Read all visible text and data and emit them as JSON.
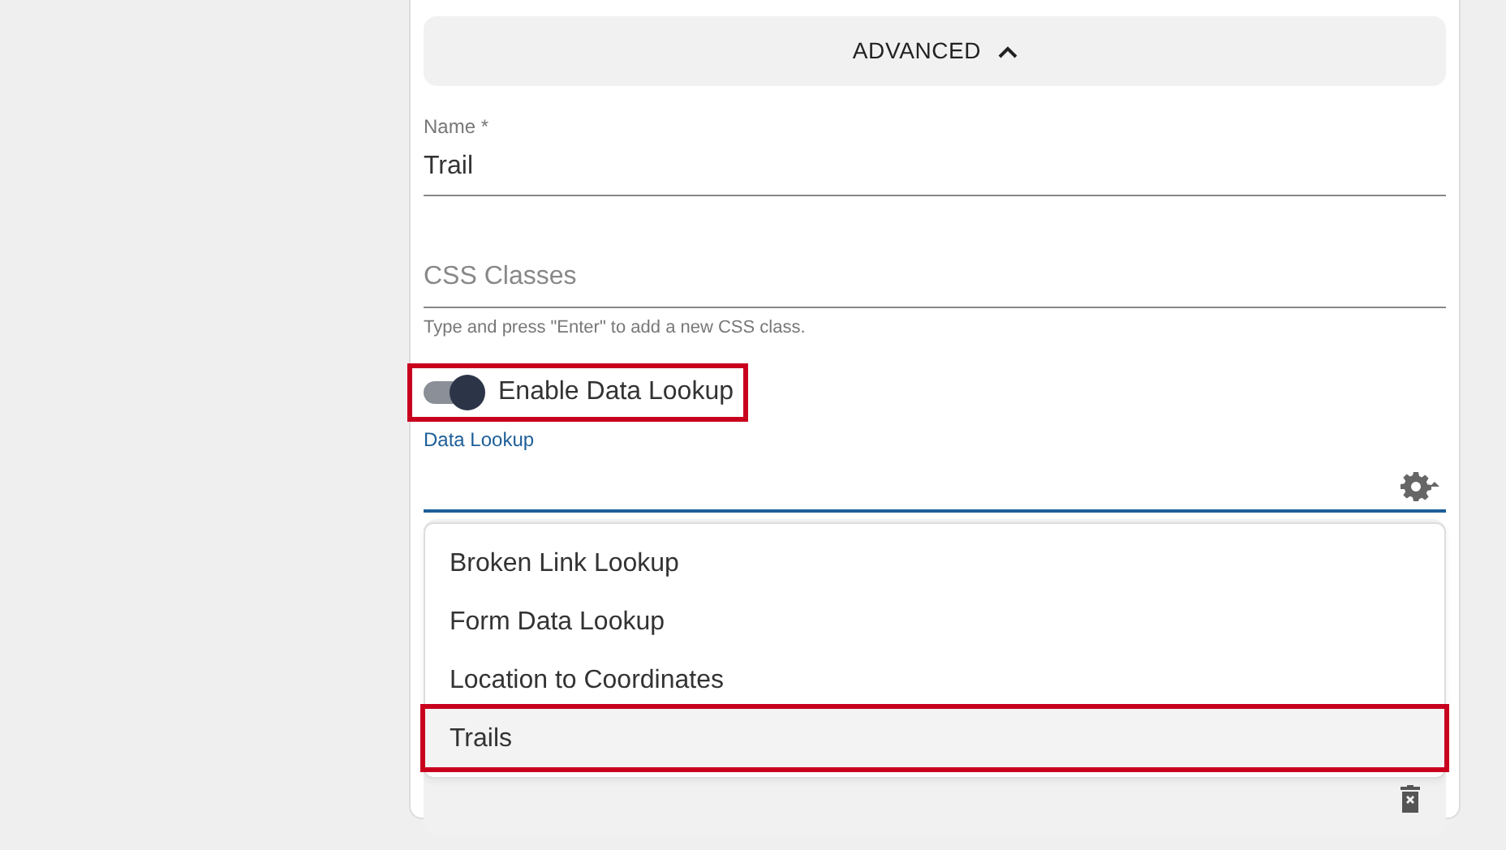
{
  "advanced_section": {
    "label": "ADVANCED",
    "expanded": true
  },
  "name_field": {
    "label": "Name *",
    "value": "Trail"
  },
  "css_classes_field": {
    "placeholder": "CSS Classes",
    "helper": "Type and press \"Enter\" to add a new CSS class."
  },
  "data_lookup_toggle": {
    "label": "Enable Data Lookup",
    "on": true,
    "highlighted": true
  },
  "data_lookup_field": {
    "label": "Data Lookup",
    "focused": true
  },
  "dropdown_options": [
    {
      "label": "Broken Link Lookup",
      "selected": false,
      "highlighted": false
    },
    {
      "label": "Form Data Lookup",
      "selected": false,
      "highlighted": false
    },
    {
      "label": "Location to Coordinates",
      "selected": false,
      "highlighted": false
    },
    {
      "label": "Trails",
      "selected": true,
      "highlighted": true
    }
  ]
}
